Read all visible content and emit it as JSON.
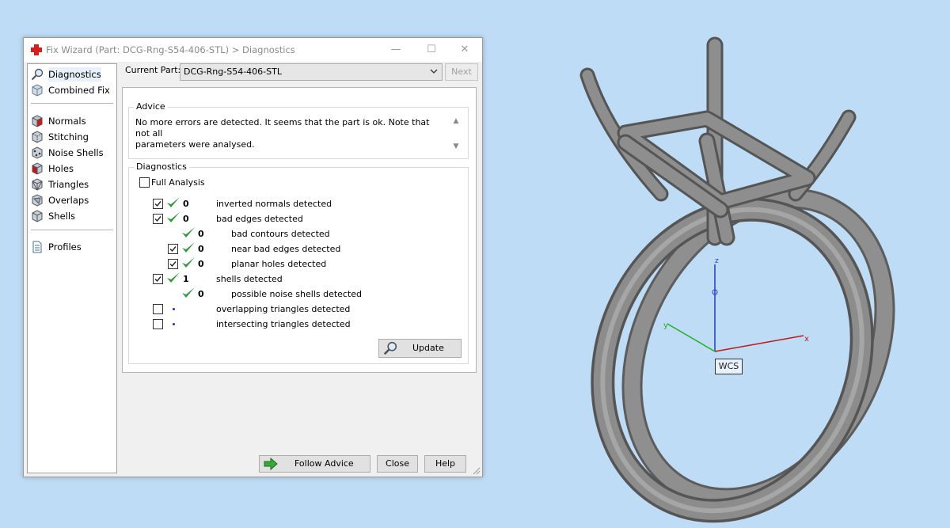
{
  "window": {
    "title": "Fix Wizard (Part: DCG-Rng-S54-406-STL) > Diagnostics",
    "controls": {
      "minimize": "—",
      "maximize": "☐",
      "close": "✕"
    }
  },
  "nav": {
    "top": [
      {
        "label": "Diagnostics",
        "selected": true,
        "icon": "magnifier-icon"
      },
      {
        "label": "Combined Fix",
        "icon": "cube-icon"
      }
    ],
    "fixes": [
      {
        "label": "Normals",
        "icon": "normals-cube-icon"
      },
      {
        "label": "Stitching",
        "icon": "stitching-cube-icon"
      },
      {
        "label": "Noise Shells",
        "icon": "noise-shells-icon"
      },
      {
        "label": "Holes",
        "icon": "holes-cube-icon"
      },
      {
        "label": "Triangles",
        "icon": "triangles-cube-icon"
      },
      {
        "label": "Overlaps",
        "icon": "overlaps-cube-icon"
      },
      {
        "label": "Shells",
        "icon": "shells-cube-icon"
      }
    ],
    "bottom": [
      {
        "label": "Profiles",
        "icon": "document-icon"
      }
    ]
  },
  "current_part": {
    "label": "Current Part:",
    "value": "DCG-Rng-S54-406-STL"
  },
  "next_button": "Next",
  "advice": {
    "title": "Advice",
    "line1": "No more errors are detected. It seems that the part is ok. Note that not all",
    "line2": "parameters were analysed."
  },
  "diagnostics": {
    "title": "Diagnostics",
    "full_analysis": "Full Analysis",
    "rows": [
      {
        "checked": true,
        "status": "ok",
        "count": "0",
        "label": "inverted normals detected",
        "level": 0
      },
      {
        "checked": true,
        "status": "ok",
        "count": "0",
        "label": "bad edges detected",
        "level": 0
      },
      {
        "checked": null,
        "status": "ok",
        "count": "0",
        "label": "bad contours detected",
        "level": 1
      },
      {
        "checked": true,
        "status": "ok",
        "count": "0",
        "label": "near bad edges detected",
        "level": 1
      },
      {
        "checked": true,
        "status": "ok",
        "count": "0",
        "label": "planar holes detected",
        "level": 1
      },
      {
        "checked": true,
        "status": "ok",
        "count": "1",
        "label": "shells detected",
        "level": 0
      },
      {
        "checked": null,
        "status": "ok",
        "count": "0",
        "label": "possible noise shells detected",
        "level": 1
      },
      {
        "checked": false,
        "status": "dot",
        "count": "",
        "label": "overlapping triangles detected",
        "level": 0
      },
      {
        "checked": false,
        "status": "dot",
        "count": "",
        "label": "intersecting triangles detected",
        "level": 0
      }
    ],
    "update_button": "Update"
  },
  "footer": {
    "follow_advice": "Follow Advice",
    "close": "Close",
    "help": "Help"
  },
  "viewport": {
    "wcs_label": "WCS",
    "axes": {
      "x": "x",
      "y": "y",
      "z": "z"
    },
    "colors": {
      "background": "#bfdcf6",
      "x_axis": "#c01818",
      "y_axis": "#22b022",
      "z_axis": "#1e3fc0",
      "model": "#8a8a8a"
    }
  },
  "colors": {
    "check_ok": "#2e9a3a",
    "accent_red": "#d21f1f",
    "dot": "#2030c0"
  }
}
